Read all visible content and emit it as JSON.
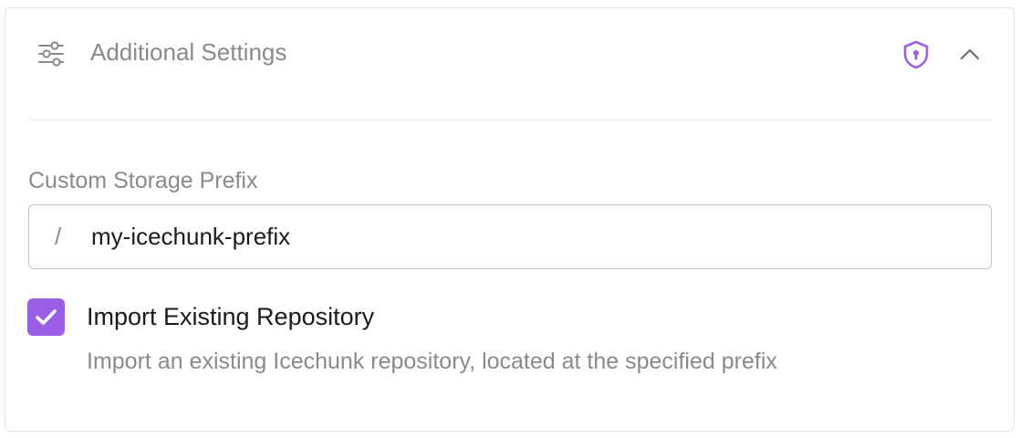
{
  "panel": {
    "title": "Additional Settings",
    "icons": {
      "settings": "sliders-icon",
      "security": "shield-lock-icon",
      "collapse": "chevron-up-icon"
    }
  },
  "storage_prefix": {
    "label": "Custom Storage Prefix",
    "slash": "/",
    "value": "my-icechunk-prefix"
  },
  "import_repo": {
    "checked": true,
    "label": "Import Existing Repository",
    "help": "Import an existing Icechunk repository, located at the specified prefix"
  },
  "colors": {
    "accent": "#9b5de5",
    "muted_text": "#8a8a8a",
    "text": "#1b1b1b"
  }
}
